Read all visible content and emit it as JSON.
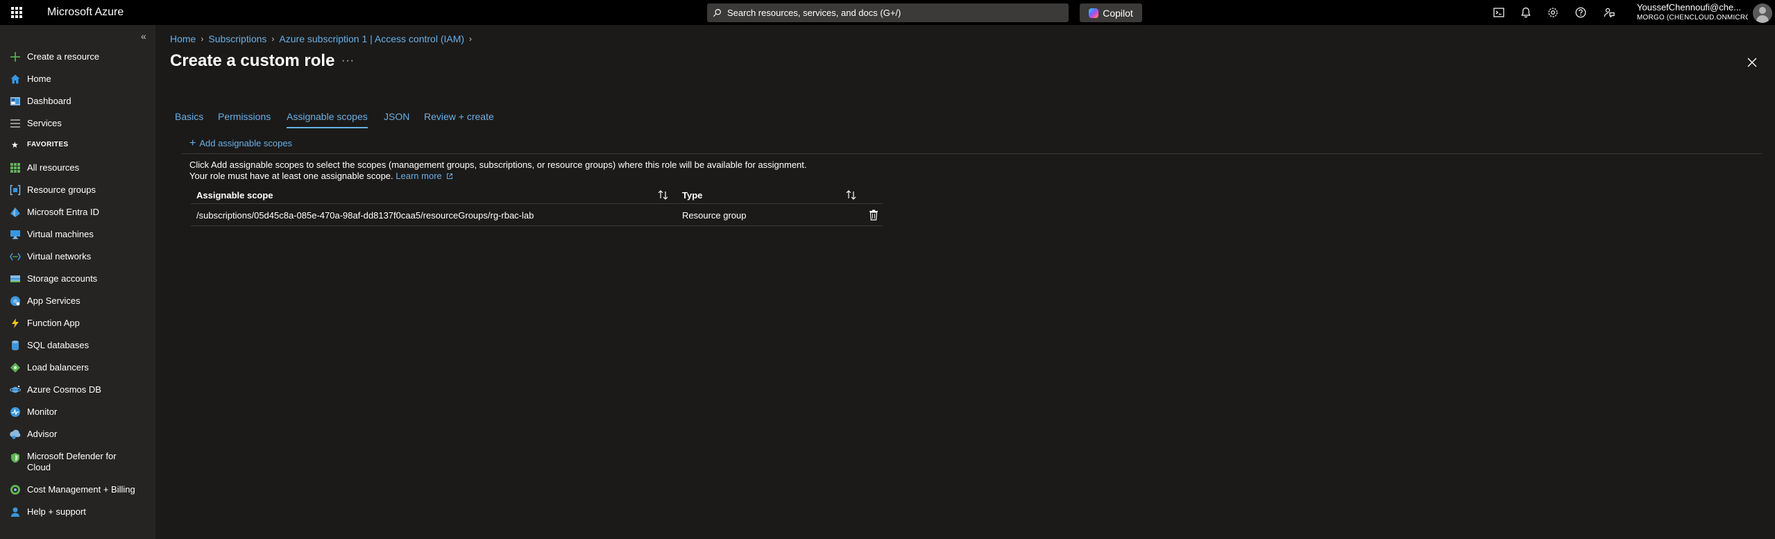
{
  "topbar": {
    "brand": "Microsoft Azure",
    "search_placeholder": "Search resources, services, and docs (G+/)",
    "copilot_label": "Copilot",
    "icons": [
      "cloud-shell-icon",
      "notifications-icon",
      "settings-icon",
      "help-icon",
      "feedback-icon"
    ],
    "account_name": "YoussefChennoufi@che...",
    "account_tenant": "MORGO (CHENCLOUD.ONMICRO..."
  },
  "sidebar": {
    "items": [
      {
        "label": "Create a resource",
        "icon": "plus-icon"
      },
      {
        "label": "Home",
        "icon": "home-icon"
      },
      {
        "label": "Dashboard",
        "icon": "dashboard-icon"
      },
      {
        "label": "Services",
        "icon": "services-list-icon"
      }
    ],
    "favorites_label": "FAVORITES",
    "favorites": [
      {
        "label": "All resources",
        "icon": "all-resources-icon"
      },
      {
        "label": "Resource groups",
        "icon": "resource-groups-icon"
      },
      {
        "label": "Microsoft Entra ID",
        "icon": "entra-id-icon"
      },
      {
        "label": "Virtual machines",
        "icon": "virtual-machines-icon"
      },
      {
        "label": "Virtual networks",
        "icon": "virtual-networks-icon"
      },
      {
        "label": "Storage accounts",
        "icon": "storage-accounts-icon"
      },
      {
        "label": "App Services",
        "icon": "app-services-icon"
      },
      {
        "label": "Function App",
        "icon": "function-app-icon"
      },
      {
        "label": "SQL databases",
        "icon": "sql-databases-icon"
      },
      {
        "label": "Load balancers",
        "icon": "load-balancers-icon"
      },
      {
        "label": "Azure Cosmos DB",
        "icon": "cosmos-db-icon"
      },
      {
        "label": "Monitor",
        "icon": "monitor-icon"
      },
      {
        "label": "Advisor",
        "icon": "advisor-icon"
      },
      {
        "label": "Microsoft Defender for Cloud",
        "icon": "defender-icon"
      },
      {
        "label": "Cost Management + Billing",
        "icon": "cost-management-icon"
      },
      {
        "label": "Help + support",
        "icon": "help-support-icon"
      }
    ]
  },
  "breadcrumb": {
    "items": [
      "Home",
      "Subscriptions",
      "Azure subscription 1 | Access control (IAM)"
    ]
  },
  "page": {
    "title": "Create a custom role",
    "more_label": "···"
  },
  "tabs": [
    {
      "label": "Basics"
    },
    {
      "label": "Permissions"
    },
    {
      "label": "Assignable scopes",
      "active": true
    },
    {
      "label": "JSON"
    },
    {
      "label": "Review + create"
    }
  ],
  "toolbar": {
    "add_label": "Add assignable scopes"
  },
  "description": {
    "line1": "Click Add assignable scopes to select the scopes (management groups, subscriptions, or resource groups) where this role will be available for assignment.",
    "line2": "Your role must have at least one assignable scope.",
    "learn_more": "Learn more"
  },
  "grid": {
    "columns": [
      "Assignable scope",
      "Type"
    ],
    "rows": [
      {
        "scope": "/subscriptions/05d45c8a-085e-470a-98af-dd8137f0caa5/resourceGroups/rg-rbac-lab",
        "type": "Resource group"
      }
    ]
  },
  "colors": {
    "accent": "#69afe5",
    "background": "#1b1a19",
    "sidebar": "#252423",
    "topbar": "#000000"
  }
}
